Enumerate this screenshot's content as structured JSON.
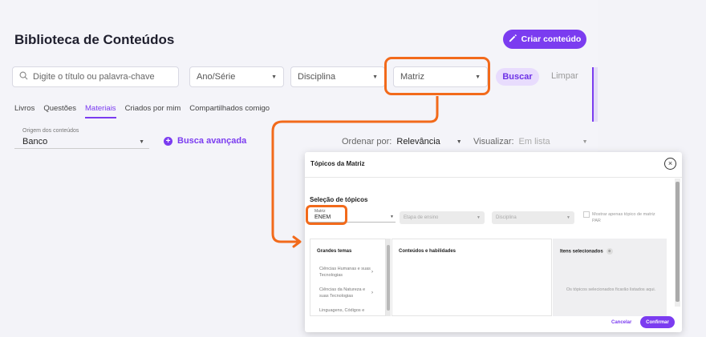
{
  "header": {
    "title": "Biblioteca de Conteúdos",
    "create_label": "Criar conteúdo"
  },
  "filters": {
    "search_placeholder": "Digite o título ou palavra-chave",
    "ano_serie": "Ano/Série",
    "disciplina": "Disciplina",
    "matriz": "Matriz",
    "buscar": "Buscar",
    "limpar": "Limpar"
  },
  "tabs": [
    {
      "label": "Livros"
    },
    {
      "label": "Questões"
    },
    {
      "label": "Materiais",
      "active": true
    },
    {
      "label": "Criados por mim"
    },
    {
      "label": "Compartilhados comigo"
    }
  ],
  "origem": {
    "label": "Origem dos conteúdos",
    "value": "Banco"
  },
  "busca_avancada": "Busca avançada",
  "ordenar": {
    "label": "Ordenar por:",
    "value": "Relevância"
  },
  "visualizar": {
    "label": "Visualizar:",
    "value": "Em lista"
  },
  "modal": {
    "title": "Tópicos da Matriz",
    "close": "×",
    "section": "Seleção de tópicos",
    "matriz_label": "Matriz",
    "matriz_value": "ENEM",
    "etapa_placeholder": "Etapa de ensino",
    "disciplina_placeholder": "Disciplina",
    "checkbox_label": "Mostrar apenas tópico de matriz PAR",
    "col1_head": "Grandes temas",
    "col2_head": "Conteúdos e habilidades",
    "col3_head": "Itens selecionados",
    "selected_count": "0",
    "themes": [
      "Ciências Humanas e suas Tecnologias",
      "Ciências da Natureza e suas Tecnologias",
      "Linguagens, Códigos e"
    ],
    "empty_message": "Os tópicos selecionados ficarão listados aqui.",
    "cancel": "Cancelar",
    "confirm": "Confirmar"
  },
  "colors": {
    "accent": "#7b3cf0",
    "highlight": "#f26a1b"
  }
}
